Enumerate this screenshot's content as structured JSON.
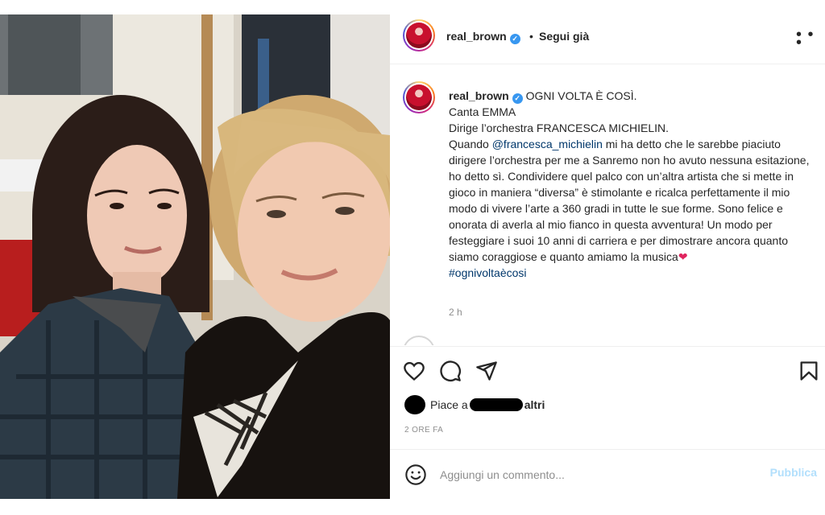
{
  "post": {
    "username": "real_brown",
    "follow_status": "Segui già",
    "separator": "•",
    "more_icon": "more-horizontal-icon",
    "photo": {
      "alt": "Selfie of two women"
    }
  },
  "caption": {
    "username": "real_brown",
    "line1": "OGNI VOLTA È COSÌ.",
    "line2": "Canta EMMA",
    "line3": "Dirige l’orchestra FRANCESCA MICHIELIN.",
    "quando": "Quando ",
    "mention": "@francesca_michielin",
    "body": " mi ha detto che le sarebbe piaciuto dirigere l’orchestra per me a Sanremo non ho avuto nessuna esitazione, ho detto sì. Condividere quel palco con un’altra artista che si mette in gioco in maniera “diversa” è stimolante e ricalca perfettamente il mio modo di vivere l’arte a 360 gradi in tutte le sue forme. Sono felice e onorata di averla al mio fianco in questa avventura! Un modo per festeggiare i suoi 10 anni di carriera e per dimostrare ancora quanto siamo coraggiose e quanto amiamo la musica",
    "heart": "❤",
    "hashtag": "#ognivoltaècosi",
    "time": "2 h"
  },
  "actions": {
    "icons": [
      "heart-outline-icon",
      "comment-icon",
      "share-icon",
      "bookmark-icon"
    ],
    "likes_prefix": "Piace a",
    "likes_suffix": "altri",
    "post_time": "2 ORE FA"
  },
  "comment": {
    "placeholder": "Aggiungi un commento...",
    "publish_label": "Pubblica",
    "emoji_icon": "emoji-smile-icon"
  }
}
